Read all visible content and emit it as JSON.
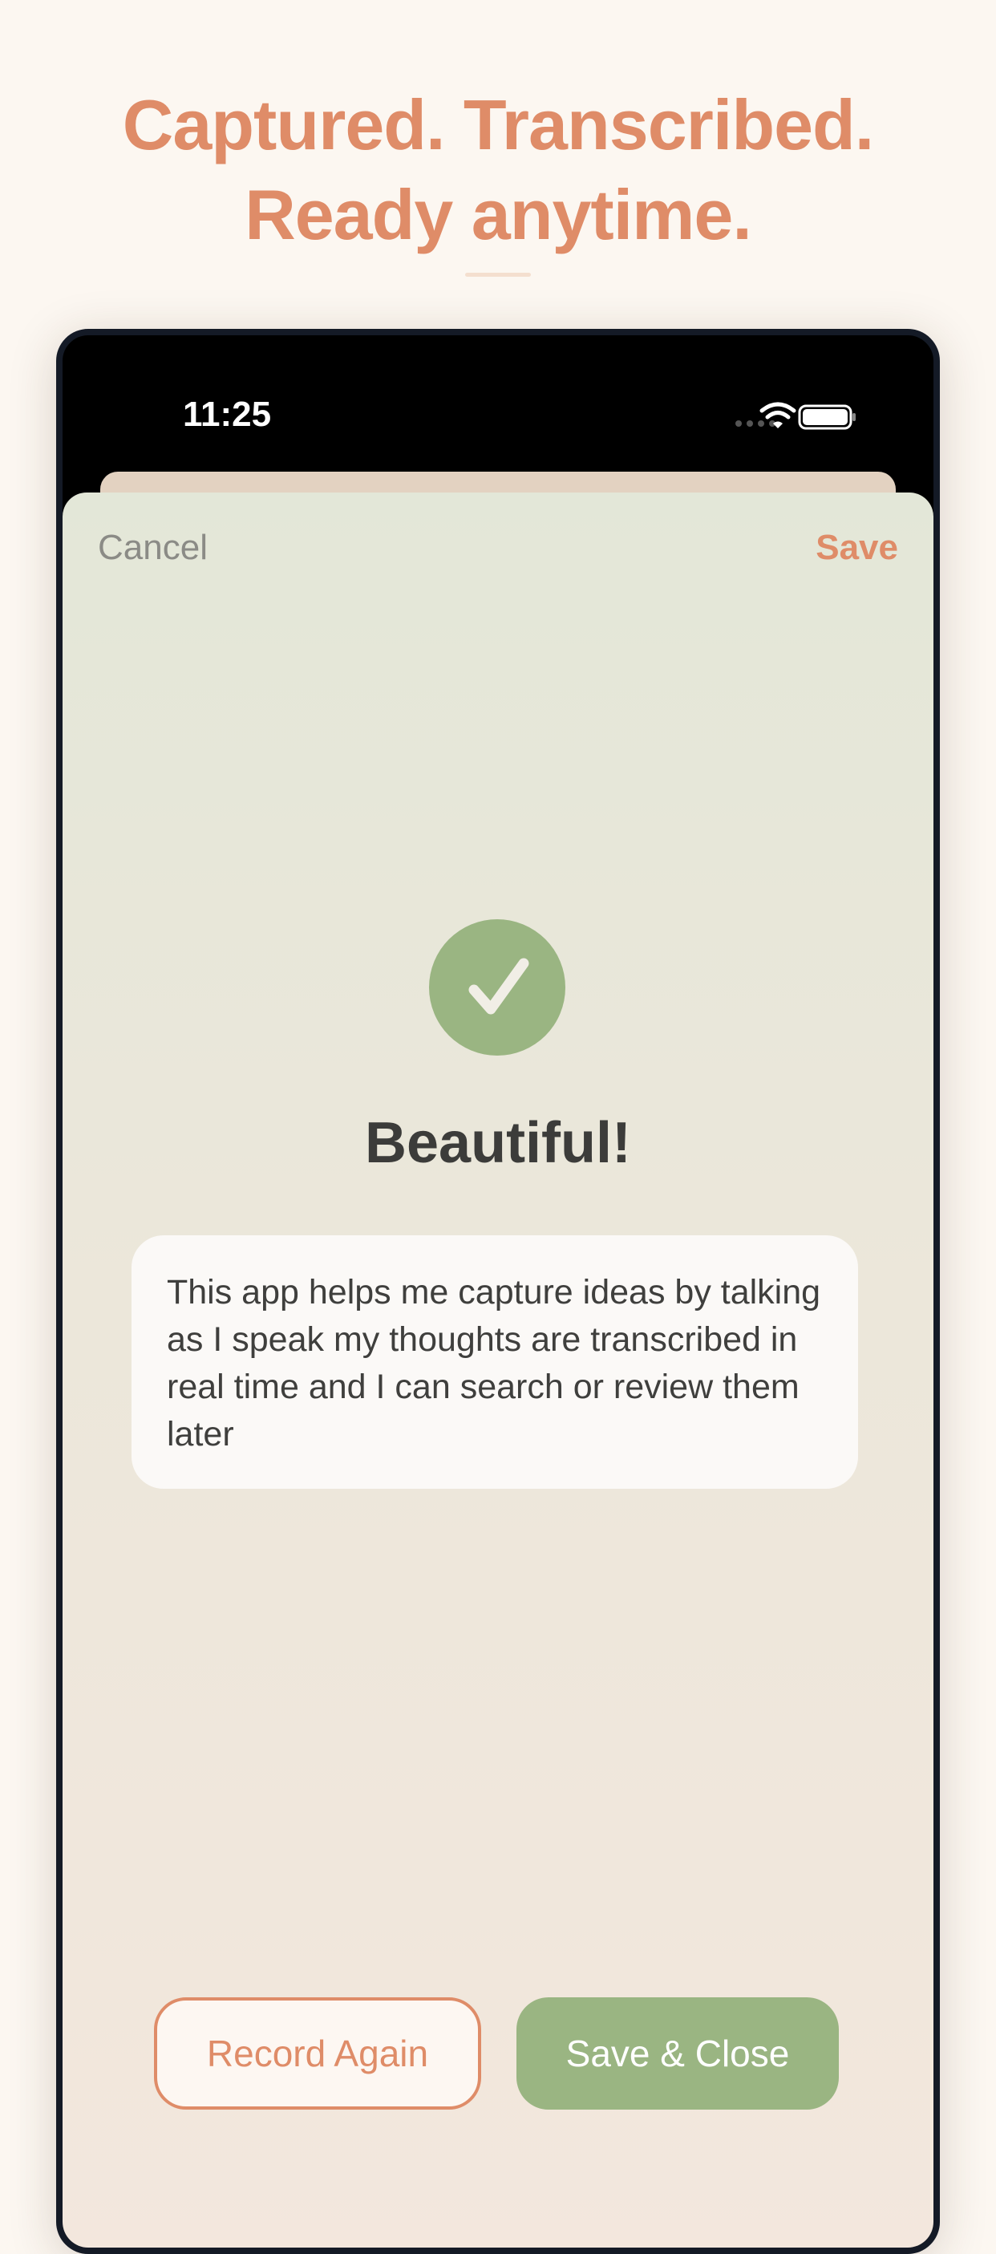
{
  "headline": {
    "line1": "Captured. Transcribed.",
    "line2": "Ready anytime."
  },
  "status_bar": {
    "time": "11:25",
    "icons": [
      "cellular-signal-icon",
      "wifi-icon",
      "battery-icon"
    ]
  },
  "sheet": {
    "cancel_label": "Cancel",
    "save_label": "Save",
    "status_icon": "checkmark-icon",
    "title": "Beautiful!",
    "transcript": "This app helps me capture ideas by talking as I speak my thoughts are transcribed in real time and I can search or review them later",
    "record_again_label": "Record Again",
    "save_close_label": "Save & Close"
  },
  "colors": {
    "accent": "#df8c68",
    "success_green": "#9ab582",
    "page_background": "#fcf7f1",
    "device_frame": "#141a26"
  }
}
